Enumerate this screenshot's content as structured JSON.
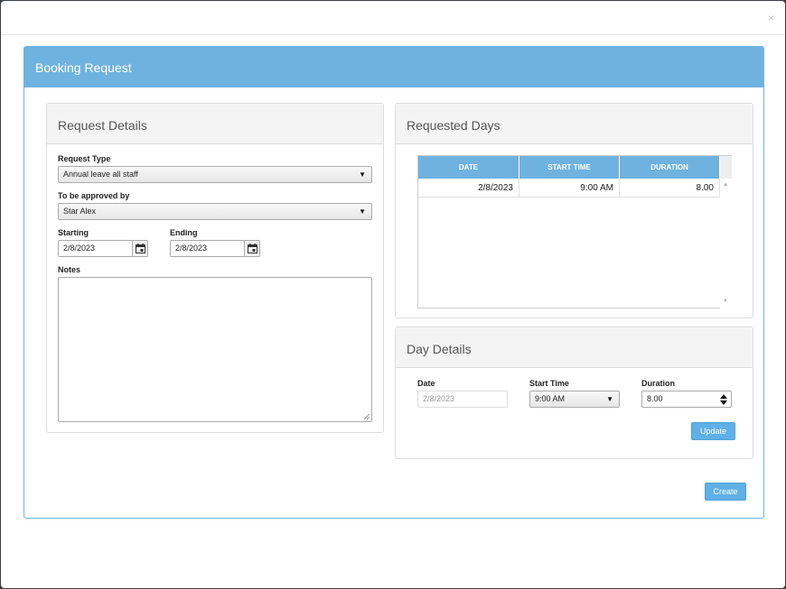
{
  "modal": {
    "close_label": "×"
  },
  "panel": {
    "title": "Booking Request"
  },
  "request_details": {
    "title": "Request Details",
    "request_type": {
      "label": "Request Type",
      "value": "Annual leave all staff"
    },
    "approver": {
      "label": "To be approved by",
      "value": "Star Alex"
    },
    "starting": {
      "label": "Starting",
      "value": "2/8/2023"
    },
    "ending": {
      "label": "Ending",
      "value": "2/8/2023"
    },
    "notes": {
      "label": "Notes",
      "value": ""
    }
  },
  "requested_days": {
    "title": "Requested Days",
    "columns": [
      "DATE",
      "START TIME",
      "DURATION"
    ],
    "rows": [
      {
        "date": "2/8/2023",
        "start_time": "9:00 AM",
        "duration": "8.00"
      }
    ]
  },
  "day_details": {
    "title": "Day Details",
    "date": {
      "label": "Date",
      "value": "2/8/2023"
    },
    "start_time": {
      "label": "Start Time",
      "value": "9:00 AM"
    },
    "duration": {
      "label": "Duration",
      "value": "8.00"
    },
    "update_label": "Update"
  },
  "create_label": "Create",
  "colors": {
    "accent": "#6fb2e0",
    "button": "#5fb0e6",
    "overlay": "#3a3f44"
  }
}
